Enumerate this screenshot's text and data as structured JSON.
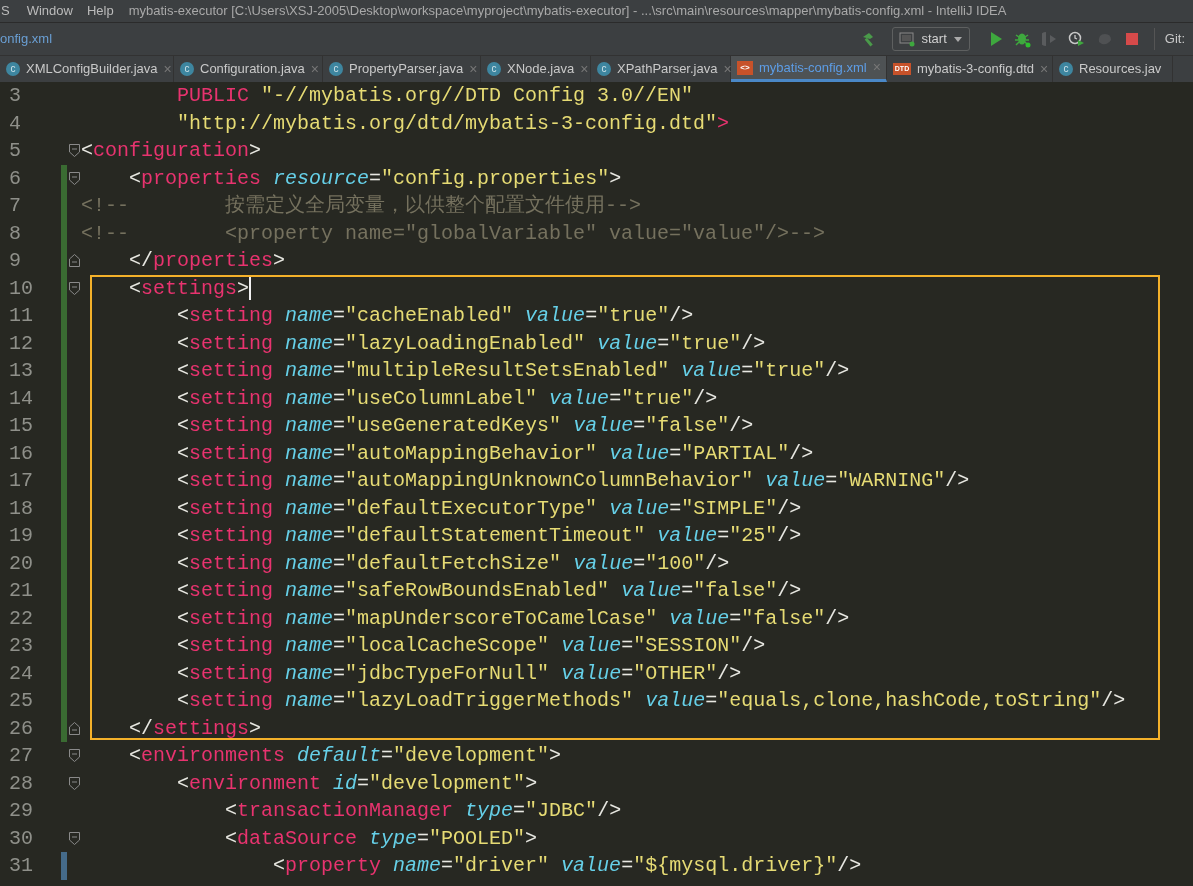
{
  "menu_bar": {
    "items": [
      {
        "label": "S"
      },
      {
        "label": "Window"
      },
      {
        "label": "Help"
      }
    ],
    "title": "mybatis-executor [C:\\Users\\XSJ-2005\\Desktop\\workspace\\myproject\\mybatis-executor] - ...\\src\\main\\resources\\mapper\\mybatis-config.xml - IntelliJ IDEA"
  },
  "nav_bar": {
    "breadcrumb": "onfig.xml",
    "run_config": "start",
    "git_label": "Git:"
  },
  "tabs": [
    {
      "label": "XMLConfigBuilder.java",
      "kind": "class",
      "badge": "c",
      "close": "×",
      "selected": false
    },
    {
      "label": "Configuration.java",
      "kind": "class",
      "badge": "c",
      "close": "×",
      "selected": false
    },
    {
      "label": "PropertyParser.java",
      "kind": "class",
      "badge": "c",
      "close": "×",
      "selected": false
    },
    {
      "label": "XNode.java",
      "kind": "class",
      "badge": "c",
      "close": "×",
      "selected": false
    },
    {
      "label": "XPathParser.java",
      "kind": "class",
      "badge": "c",
      "close": "×",
      "selected": false
    },
    {
      "label": "mybatis-config.xml",
      "kind": "xml",
      "badge": "<>",
      "close": "×",
      "selected": true
    },
    {
      "label": "mybatis-3-config.dtd",
      "kind": "dtd",
      "badge": "DTD",
      "close": "×",
      "selected": false
    },
    {
      "label": "Resources.jav",
      "kind": "class",
      "badge": "c",
      "selected": false
    }
  ],
  "editor": {
    "blocks": [
      {
        "framed": false,
        "lines": [
          {
            "number": "3",
            "fold_start": false,
            "fold_end": false,
            "added": false,
            "modified": false,
            "cursor": false,
            "tokens": [
              {
                "kind": "keyword",
                "text": "        PUBLIC"
              },
              {
                "kind": "string",
                "text": " \"-//mybatis.org//DTD Config 3.0//EN\""
              }
            ]
          },
          {
            "number": "4",
            "fold_start": false,
            "fold_end": false,
            "added": false,
            "modified": false,
            "cursor": false,
            "tokens": [
              {
                "kind": "string",
                "text": "        \"http://mybatis.org/dtd/mybatis-3-config.dtd\""
              },
              {
                "kind": "tag",
                "text": ">"
              }
            ]
          },
          {
            "number": "5",
            "fold_start": true,
            "fold_end": false,
            "added": false,
            "modified": false,
            "cursor": false,
            "tokens": [
              {
                "kind": "bracket",
                "text": "<"
              },
              {
                "kind": "tag",
                "text": "configuration"
              },
              {
                "kind": "bracket",
                "text": ">"
              }
            ]
          },
          {
            "number": "6",
            "fold_start": true,
            "fold_end": false,
            "added": true,
            "modified": false,
            "cursor": false,
            "tokens": [
              {
                "kind": "bracket",
                "text": "    <"
              },
              {
                "kind": "tag",
                "text": "properties"
              },
              {
                "kind": "attr",
                "text": " resource"
              },
              {
                "kind": "bracket",
                "text": "="
              },
              {
                "kind": "string",
                "text": "\"config.properties\""
              },
              {
                "kind": "bracket",
                "text": ">"
              }
            ]
          },
          {
            "number": "7",
            "fold_start": false,
            "fold_end": false,
            "added": true,
            "modified": false,
            "cursor": false,
            "tokens": [
              {
                "kind": "comment",
                "text": "<!--        按需定义全局变量，以供整个配置文件使用-->"
              }
            ]
          },
          {
            "number": "8",
            "fold_start": false,
            "fold_end": false,
            "added": true,
            "modified": false,
            "cursor": false,
            "tokens": [
              {
                "kind": "comment",
                "text": "<!--        <property name=\"globalVariable\" value=\"value\"/>-->"
              }
            ]
          },
          {
            "number": "9",
            "fold_start": false,
            "fold_end": true,
            "added": true,
            "modified": false,
            "cursor": false,
            "tokens": [
              {
                "kind": "bracket",
                "text": "    </"
              },
              {
                "kind": "tag",
                "text": "properties"
              },
              {
                "kind": "bracket",
                "text": ">"
              }
            ]
          }
        ]
      },
      {
        "framed": true,
        "lines": [
          {
            "number": "10",
            "fold_start": true,
            "fold_end": false,
            "added": true,
            "modified": false,
            "cursor": true,
            "tokens": [
              {
                "kind": "bracket",
                "text": "    <"
              },
              {
                "kind": "tag",
                "text": "settings"
              },
              {
                "kind": "bracket",
                "text": ">"
              }
            ]
          },
          {
            "number": "11",
            "fold_start": false,
            "fold_end": false,
            "added": true,
            "modified": false,
            "cursor": false,
            "tokens": [
              {
                "kind": "bracket",
                "text": "        <"
              },
              {
                "kind": "tag",
                "text": "setting"
              },
              {
                "kind": "attr",
                "text": " name"
              },
              {
                "kind": "bracket",
                "text": "="
              },
              {
                "kind": "string",
                "text": "\"cacheEnabled\""
              },
              {
                "kind": "attr",
                "text": " value"
              },
              {
                "kind": "bracket",
                "text": "="
              },
              {
                "kind": "string",
                "text": "\"true\""
              },
              {
                "kind": "bracket",
                "text": "/>"
              }
            ]
          },
          {
            "number": "12",
            "fold_start": false,
            "fold_end": false,
            "added": true,
            "modified": false,
            "cursor": false,
            "tokens": [
              {
                "kind": "bracket",
                "text": "        <"
              },
              {
                "kind": "tag",
                "text": "setting"
              },
              {
                "kind": "attr",
                "text": " name"
              },
              {
                "kind": "bracket",
                "text": "="
              },
              {
                "kind": "string",
                "text": "\"lazyLoadingEnabled\""
              },
              {
                "kind": "attr",
                "text": " value"
              },
              {
                "kind": "bracket",
                "text": "="
              },
              {
                "kind": "string",
                "text": "\"true\""
              },
              {
                "kind": "bracket",
                "text": "/>"
              }
            ]
          },
          {
            "number": "13",
            "fold_start": false,
            "fold_end": false,
            "added": true,
            "modified": false,
            "cursor": false,
            "tokens": [
              {
                "kind": "bracket",
                "text": "        <"
              },
              {
                "kind": "tag",
                "text": "setting"
              },
              {
                "kind": "attr",
                "text": " name"
              },
              {
                "kind": "bracket",
                "text": "="
              },
              {
                "kind": "string",
                "text": "\"multipleResultSetsEnabled\""
              },
              {
                "kind": "attr",
                "text": " value"
              },
              {
                "kind": "bracket",
                "text": "="
              },
              {
                "kind": "string",
                "text": "\"true\""
              },
              {
                "kind": "bracket",
                "text": "/>"
              }
            ]
          },
          {
            "number": "14",
            "fold_start": false,
            "fold_end": false,
            "added": true,
            "modified": false,
            "cursor": false,
            "tokens": [
              {
                "kind": "bracket",
                "text": "        <"
              },
              {
                "kind": "tag",
                "text": "setting"
              },
              {
                "kind": "attr",
                "text": " name"
              },
              {
                "kind": "bracket",
                "text": "="
              },
              {
                "kind": "string",
                "text": "\"useColumnLabel\""
              },
              {
                "kind": "attr",
                "text": " value"
              },
              {
                "kind": "bracket",
                "text": "="
              },
              {
                "kind": "string",
                "text": "\"true\""
              },
              {
                "kind": "bracket",
                "text": "/>"
              }
            ]
          },
          {
            "number": "15",
            "fold_start": false,
            "fold_end": false,
            "added": true,
            "modified": false,
            "cursor": false,
            "tokens": [
              {
                "kind": "bracket",
                "text": "        <"
              },
              {
                "kind": "tag",
                "text": "setting"
              },
              {
                "kind": "attr",
                "text": " name"
              },
              {
                "kind": "bracket",
                "text": "="
              },
              {
                "kind": "string",
                "text": "\"useGeneratedKeys\""
              },
              {
                "kind": "attr",
                "text": " value"
              },
              {
                "kind": "bracket",
                "text": "="
              },
              {
                "kind": "string",
                "text": "\"false\""
              },
              {
                "kind": "bracket",
                "text": "/>"
              }
            ]
          },
          {
            "number": "16",
            "fold_start": false,
            "fold_end": false,
            "added": true,
            "modified": false,
            "cursor": false,
            "tokens": [
              {
                "kind": "bracket",
                "text": "        <"
              },
              {
                "kind": "tag",
                "text": "setting"
              },
              {
                "kind": "attr",
                "text": " name"
              },
              {
                "kind": "bracket",
                "text": "="
              },
              {
                "kind": "string",
                "text": "\"autoMappingBehavior\""
              },
              {
                "kind": "attr",
                "text": " value"
              },
              {
                "kind": "bracket",
                "text": "="
              },
              {
                "kind": "string",
                "text": "\"PARTIAL\""
              },
              {
                "kind": "bracket",
                "text": "/>"
              }
            ]
          },
          {
            "number": "17",
            "fold_start": false,
            "fold_end": false,
            "added": true,
            "modified": false,
            "cursor": false,
            "tokens": [
              {
                "kind": "bracket",
                "text": "        <"
              },
              {
                "kind": "tag",
                "text": "setting"
              },
              {
                "kind": "attr",
                "text": " name"
              },
              {
                "kind": "bracket",
                "text": "="
              },
              {
                "kind": "string",
                "text": "\"autoMappingUnknownColumnBehavior\""
              },
              {
                "kind": "attr",
                "text": " value"
              },
              {
                "kind": "bracket",
                "text": "="
              },
              {
                "kind": "string",
                "text": "\"WARNING\""
              },
              {
                "kind": "bracket",
                "text": "/>"
              }
            ]
          },
          {
            "number": "18",
            "fold_start": false,
            "fold_end": false,
            "added": true,
            "modified": false,
            "cursor": false,
            "tokens": [
              {
                "kind": "bracket",
                "text": "        <"
              },
              {
                "kind": "tag",
                "text": "setting"
              },
              {
                "kind": "attr",
                "text": " name"
              },
              {
                "kind": "bracket",
                "text": "="
              },
              {
                "kind": "string",
                "text": "\"defaultExecutorType\""
              },
              {
                "kind": "attr",
                "text": " value"
              },
              {
                "kind": "bracket",
                "text": "="
              },
              {
                "kind": "string",
                "text": "\"SIMPLE\""
              },
              {
                "kind": "bracket",
                "text": "/>"
              }
            ]
          },
          {
            "number": "19",
            "fold_start": false,
            "fold_end": false,
            "added": true,
            "modified": false,
            "cursor": false,
            "tokens": [
              {
                "kind": "bracket",
                "text": "        <"
              },
              {
                "kind": "tag",
                "text": "setting"
              },
              {
                "kind": "attr",
                "text": " name"
              },
              {
                "kind": "bracket",
                "text": "="
              },
              {
                "kind": "string",
                "text": "\"defaultStatementTimeout\""
              },
              {
                "kind": "attr",
                "text": " value"
              },
              {
                "kind": "bracket",
                "text": "="
              },
              {
                "kind": "string",
                "text": "\"25\""
              },
              {
                "kind": "bracket",
                "text": "/>"
              }
            ]
          },
          {
            "number": "20",
            "fold_start": false,
            "fold_end": false,
            "added": true,
            "modified": false,
            "cursor": false,
            "tokens": [
              {
                "kind": "bracket",
                "text": "        <"
              },
              {
                "kind": "tag",
                "text": "setting"
              },
              {
                "kind": "attr",
                "text": " name"
              },
              {
                "kind": "bracket",
                "text": "="
              },
              {
                "kind": "string",
                "text": "\"defaultFetchSize\""
              },
              {
                "kind": "attr",
                "text": " value"
              },
              {
                "kind": "bracket",
                "text": "="
              },
              {
                "kind": "string",
                "text": "\"100\""
              },
              {
                "kind": "bracket",
                "text": "/>"
              }
            ]
          },
          {
            "number": "21",
            "fold_start": false,
            "fold_end": false,
            "added": true,
            "modified": false,
            "cursor": false,
            "tokens": [
              {
                "kind": "bracket",
                "text": "        <"
              },
              {
                "kind": "tag",
                "text": "setting"
              },
              {
                "kind": "attr",
                "text": " name"
              },
              {
                "kind": "bracket",
                "text": "="
              },
              {
                "kind": "string",
                "text": "\"safeRowBoundsEnabled\""
              },
              {
                "kind": "attr",
                "text": " value"
              },
              {
                "kind": "bracket",
                "text": "="
              },
              {
                "kind": "string",
                "text": "\"false\""
              },
              {
                "kind": "bracket",
                "text": "/>"
              }
            ]
          },
          {
            "number": "22",
            "fold_start": false,
            "fold_end": false,
            "added": true,
            "modified": false,
            "cursor": false,
            "tokens": [
              {
                "kind": "bracket",
                "text": "        <"
              },
              {
                "kind": "tag",
                "text": "setting"
              },
              {
                "kind": "attr",
                "text": " name"
              },
              {
                "kind": "bracket",
                "text": "="
              },
              {
                "kind": "string",
                "text": "\"mapUnderscoreToCamelCase\""
              },
              {
                "kind": "attr",
                "text": " value"
              },
              {
                "kind": "bracket",
                "text": "="
              },
              {
                "kind": "string",
                "text": "\"false\""
              },
              {
                "kind": "bracket",
                "text": "/>"
              }
            ]
          },
          {
            "number": "23",
            "fold_start": false,
            "fold_end": false,
            "added": true,
            "modified": false,
            "cursor": false,
            "tokens": [
              {
                "kind": "bracket",
                "text": "        <"
              },
              {
                "kind": "tag",
                "text": "setting"
              },
              {
                "kind": "attr",
                "text": " name"
              },
              {
                "kind": "bracket",
                "text": "="
              },
              {
                "kind": "string",
                "text": "\"localCacheScope\""
              },
              {
                "kind": "attr",
                "text": " value"
              },
              {
                "kind": "bracket",
                "text": "="
              },
              {
                "kind": "string",
                "text": "\"SESSION\""
              },
              {
                "kind": "bracket",
                "text": "/>"
              }
            ]
          },
          {
            "number": "24",
            "fold_start": false,
            "fold_end": false,
            "added": true,
            "modified": false,
            "cursor": false,
            "tokens": [
              {
                "kind": "bracket",
                "text": "        <"
              },
              {
                "kind": "tag",
                "text": "setting"
              },
              {
                "kind": "attr",
                "text": " name"
              },
              {
                "kind": "bracket",
                "text": "="
              },
              {
                "kind": "string",
                "text": "\"jdbcTypeForNull\""
              },
              {
                "kind": "attr",
                "text": " value"
              },
              {
                "kind": "bracket",
                "text": "="
              },
              {
                "kind": "string",
                "text": "\"OTHER\""
              },
              {
                "kind": "bracket",
                "text": "/>"
              }
            ]
          },
          {
            "number": "25",
            "fold_start": false,
            "fold_end": false,
            "added": true,
            "modified": false,
            "cursor": false,
            "tokens": [
              {
                "kind": "bracket",
                "text": "        <"
              },
              {
                "kind": "tag",
                "text": "setting"
              },
              {
                "kind": "attr",
                "text": " name"
              },
              {
                "kind": "bracket",
                "text": "="
              },
              {
                "kind": "string",
                "text": "\"lazyLoadTriggerMethods\""
              },
              {
                "kind": "attr",
                "text": " value"
              },
              {
                "kind": "bracket",
                "text": "="
              },
              {
                "kind": "string",
                "text": "\"equals,clone,hashCode,toString\""
              },
              {
                "kind": "bracket",
                "text": "/>"
              }
            ]
          },
          {
            "number": "26",
            "fold_start": false,
            "fold_end": true,
            "added": true,
            "modified": false,
            "cursor": false,
            "tokens": [
              {
                "kind": "bracket",
                "text": "    </"
              },
              {
                "kind": "tag",
                "text": "settings"
              },
              {
                "kind": "bracket",
                "text": ">"
              }
            ]
          }
        ]
      },
      {
        "framed": false,
        "lines": [
          {
            "number": "27",
            "fold_start": true,
            "fold_end": false,
            "added": false,
            "modified": false,
            "cursor": false,
            "tokens": [
              {
                "kind": "bracket",
                "text": "    <"
              },
              {
                "kind": "tag",
                "text": "environments"
              },
              {
                "kind": "attr",
                "text": " default"
              },
              {
                "kind": "bracket",
                "text": "="
              },
              {
                "kind": "string",
                "text": "\"development\""
              },
              {
                "kind": "bracket",
                "text": ">"
              }
            ]
          },
          {
            "number": "28",
            "fold_start": true,
            "fold_end": false,
            "added": false,
            "modified": false,
            "cursor": false,
            "tokens": [
              {
                "kind": "bracket",
                "text": "        <"
              },
              {
                "kind": "tag",
                "text": "environment"
              },
              {
                "kind": "attr",
                "text": " id"
              },
              {
                "kind": "bracket",
                "text": "="
              },
              {
                "kind": "string",
                "text": "\"development\""
              },
              {
                "kind": "bracket",
                "text": ">"
              }
            ]
          },
          {
            "number": "29",
            "fold_start": false,
            "fold_end": false,
            "added": false,
            "modified": false,
            "cursor": false,
            "tokens": [
              {
                "kind": "bracket",
                "text": "            <"
              },
              {
                "kind": "tag",
                "text": "transactionManager"
              },
              {
                "kind": "attr",
                "text": " type"
              },
              {
                "kind": "bracket",
                "text": "="
              },
              {
                "kind": "string",
                "text": "\"JDBC\""
              },
              {
                "kind": "bracket",
                "text": "/>"
              }
            ]
          },
          {
            "number": "30",
            "fold_start": true,
            "fold_end": false,
            "added": false,
            "modified": false,
            "cursor": false,
            "tokens": [
              {
                "kind": "bracket",
                "text": "            <"
              },
              {
                "kind": "tag",
                "text": "dataSource"
              },
              {
                "kind": "attr",
                "text": " type"
              },
              {
                "kind": "bracket",
                "text": "="
              },
              {
                "kind": "string",
                "text": "\"POOLED\""
              },
              {
                "kind": "bracket",
                "text": ">"
              }
            ]
          },
          {
            "number": "31",
            "fold_start": false,
            "fold_end": false,
            "added": false,
            "modified": true,
            "cursor": false,
            "tokens": [
              {
                "kind": "bracket",
                "text": "                <"
              },
              {
                "kind": "tag",
                "text": "property"
              },
              {
                "kind": "attr",
                "text": " name"
              },
              {
                "kind": "bracket",
                "text": "="
              },
              {
                "kind": "string",
                "text": "\"driver\""
              },
              {
                "kind": "attr",
                "text": " value"
              },
              {
                "kind": "bracket",
                "text": "="
              },
              {
                "kind": "string",
                "text": "\"${mysql.driver}\""
              },
              {
                "kind": "bracket",
                "text": "/>"
              }
            ]
          }
        ]
      }
    ]
  }
}
